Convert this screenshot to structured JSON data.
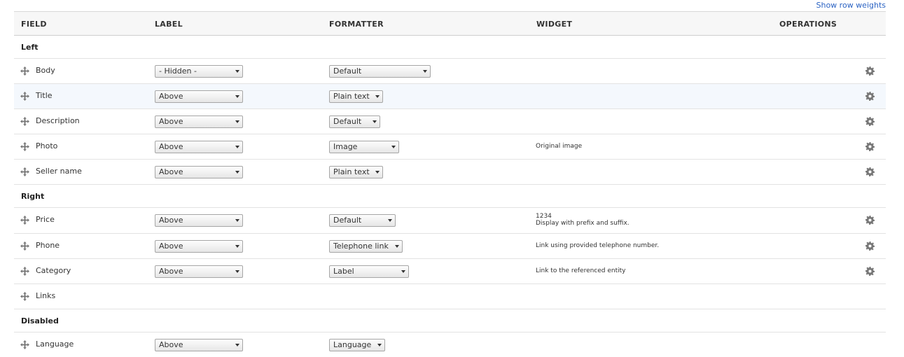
{
  "top_link": "Show row weights",
  "headers": {
    "field": "FIELD",
    "label": "LABEL",
    "formatter": "FORMATTER",
    "widget": "WIDGET",
    "operations": "OPERATIONS"
  },
  "regions": {
    "left": "Left",
    "right": "Right",
    "disabled": "Disabled"
  },
  "rows": {
    "body": {
      "name": "Body",
      "label": "- Hidden -",
      "formatter": "Default"
    },
    "title": {
      "name": "Title",
      "label": "Above",
      "formatter": "Plain text"
    },
    "description": {
      "name": "Description",
      "label": "Above",
      "formatter": "Default"
    },
    "photo": {
      "name": "Photo",
      "label": "Above",
      "formatter": "Image",
      "widget": "Original image"
    },
    "seller": {
      "name": "Seller name",
      "label": "Above",
      "formatter": "Plain text"
    },
    "price": {
      "name": "Price",
      "label": "Above",
      "formatter": "Default",
      "widget_line1": "1234",
      "widget_line2": "Display with prefix and suffix."
    },
    "phone": {
      "name": "Phone",
      "label": "Above",
      "formatter": "Telephone link",
      "widget": "Link using provided telephone number."
    },
    "category": {
      "name": "Category",
      "label": "Above",
      "formatter": "Label",
      "widget": "Link to the referenced entity"
    },
    "links": {
      "name": "Links"
    },
    "language": {
      "name": "Language",
      "label": "Above",
      "formatter": "Language"
    }
  },
  "icons": {
    "drag": "move-arrows-icon",
    "operations": "gear-icon",
    "select": "chevron-down-icon"
  },
  "colors": {
    "link": "#2b63c3",
    "header_bg": "#f7f7f7",
    "highlight_row": "#f4f8fd"
  }
}
